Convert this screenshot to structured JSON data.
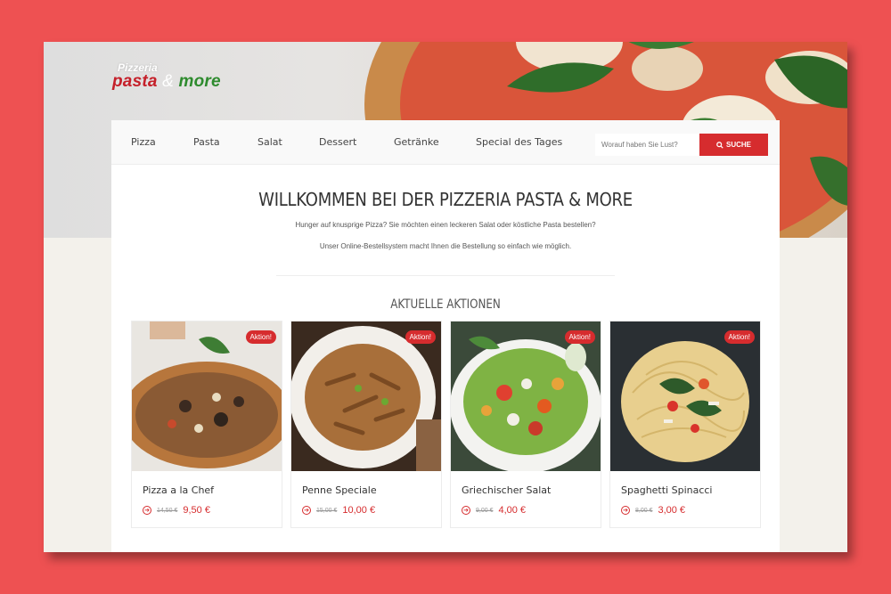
{
  "logo": {
    "line1": "Pizzeria",
    "word1": "pasta",
    "amp": "&",
    "word2": "more"
  },
  "nav": {
    "items": [
      "Pizza",
      "Pasta",
      "Salat",
      "Dessert",
      "Getränke",
      "Special des Tages"
    ],
    "search_placeholder": "Worauf haben Sie Lust?",
    "search_button": "SUCHE"
  },
  "welcome": {
    "title": "WILLKOMMEN BEI DER PIZZERIA PASTA & MORE",
    "text1": "Hunger auf knusprige Pizza? Sie möchten einen leckeren Salat oder köstliche Pasta bestellen?",
    "text2": "Unser Online-Bestellsystem macht Ihnen die Bestellung so einfach wie möglich."
  },
  "actions": {
    "title": "AKTUELLE AKTIONEN",
    "products": [
      {
        "badge": "Aktion!",
        "name": "Pizza a la Chef",
        "old_price": "14,50 €",
        "new_price": "9,50 €"
      },
      {
        "badge": "Aktion!",
        "name": "Penne Speciale",
        "old_price": "15,00 €",
        "new_price": "10,00 €"
      },
      {
        "badge": "Aktion!",
        "name": "Griechischer Salat",
        "old_price": "9,00 €",
        "new_price": "4,00 €"
      },
      {
        "badge": "Aktion!",
        "name": "Spaghetti Spinacci",
        "old_price": "8,00 €",
        "new_price": "3,00 €"
      }
    ]
  },
  "colors": {
    "accent": "#d62c2e",
    "background": "#ee5152"
  }
}
